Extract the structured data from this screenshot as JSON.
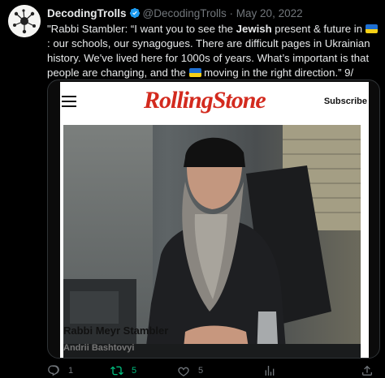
{
  "tweet": {
    "display_name": "DecodingTrolls",
    "handle": "@DecodingTrolls",
    "separator": "·",
    "date": "May 20, 2022",
    "text_parts": {
      "p1": "\"Rabbi Stambler: “I want you to see the ",
      "bold": "Jewish",
      "p2": " present & future in ",
      "p3": ": our schools, our synagogues. There are difficult pages in Ukrainian history. We've lived here for 1000s of years. What’s important is that people are changing, and the ",
      "p4": " moving in the right direction.” 9/"
    },
    "emoji": "ukraine-flag"
  },
  "card": {
    "brand": "RollingStone",
    "subscribe_label": "Subscribe",
    "menu_icon": "hamburger-menu-icon",
    "caption_title": "Rabbi Meyr Stambler",
    "caption_credit": "Andrii Bashtovyi"
  },
  "actions": {
    "reply_count": "1",
    "retweet_count": "5",
    "like_count": "5",
    "views_count": ""
  },
  "colors": {
    "background": "#000000",
    "text": "#e7e9ea",
    "muted": "#71767b",
    "retweet_green": "#00ba7c",
    "verified_blue": "#1d9bf0",
    "rollingstone_red": "#d32a1e",
    "flag_blue": "#1f6fd1",
    "flag_yellow": "#f7d117"
  }
}
